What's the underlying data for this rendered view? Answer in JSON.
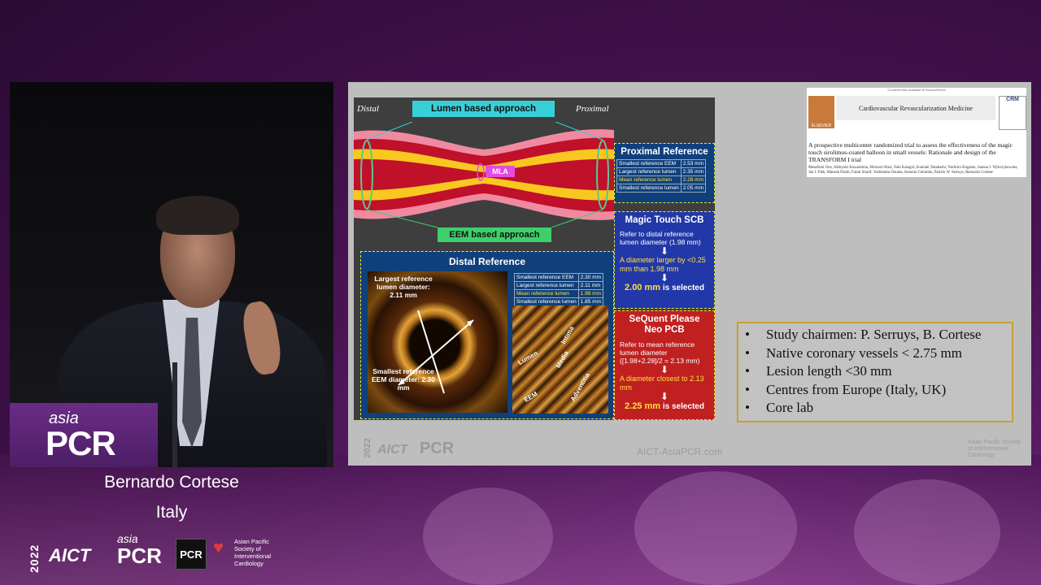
{
  "speaker": {
    "name": "Bernardo Cortese",
    "country": "Italy"
  },
  "branding": {
    "year": "2022",
    "aict": "AICT",
    "asia": "asia",
    "pcr": "PCR",
    "pcr_box": "PCR",
    "society": "Asian Pacific Society of Interventional Cardiology"
  },
  "podium": {
    "small": "asia",
    "big": "PCR"
  },
  "slide": {
    "diagram": {
      "label_distal": "Distal",
      "label_proximal": "Proximal",
      "lumen_badge": "Lumen based approach",
      "eem_badge": "EEM based approach",
      "mla": "MLA",
      "proximal_ref": {
        "title": "Proximal Reference",
        "rows": [
          {
            "label": "Smallest reference EEM",
            "value": "2.53 mm"
          },
          {
            "label": "Largest reference lumen",
            "value": "2.35 mm"
          },
          {
            "label": "Mean reference lumen",
            "value": "2.28 mm"
          },
          {
            "label": "Smallest reference lumen",
            "value": "2.05 mm"
          }
        ]
      },
      "distal_ref": {
        "title": "Distal Reference",
        "largest_label": "Largest reference lumen diameter: 2.11 mm",
        "smallest_label": "Smallest reference EEM diameter: 2.30 mm",
        "rows": [
          {
            "label": "Smallest reference EEM",
            "value": "2.30 mm"
          },
          {
            "label": "Largest reference lumen",
            "value": "2.11 mm"
          },
          {
            "label": "Mean reference lumen",
            "value": "1.98 mm"
          },
          {
            "label": "Smallest reference lumen",
            "value": "1.85 mm"
          }
        ],
        "layers": [
          "Lumen",
          "Intima",
          "Media",
          "Adventitia",
          "EEM"
        ]
      },
      "scb": {
        "title": "Magic Touch SCB",
        "text1": "Refer to distal reference lumen diameter (1.98 mm)",
        "text2": "A diameter larger by <0.25 mm than 1.98 mm",
        "result_value": "2.00 mm",
        "result_suffix": " is selected"
      },
      "pcb": {
        "title": "SeQuent Please Neo PCB",
        "text1": "Refer to mean reference lumen diameter ([1.98+2.28]/2 = 2.13 mm)",
        "text2": "A diameter closest to 2.13 mm",
        "result_value": "2.25 mm",
        "result_suffix": " is selected"
      }
    },
    "paper": {
      "top": "Contents lists available at ScienceDirect",
      "journal": "Cardiovascular Revascularization Medicine",
      "publisher": "ELSEVIER",
      "crm": "CRM",
      "title": "A prospective multicenter randomized trial to assess the effectiveness of the magic touch sirolimus-coated balloon in small vessels: Rationale and design of the TRANSFORM I trial",
      "authors": "Masafumi Ono, Hideyuki Kawashima, Hironori Hara, Yuki Katagiri, Kuniaki Takahashi, Norihiro Kogame, Joanna J. Wykrzykowska, Jan J. Piek, Manesh Doshi, Faisal Sharif, Yoshinobu Onuma, Antonio Colombo, Patrick W. Serruys, Bernardo Cortese"
    },
    "bullets": [
      "Study chairmen: P. Serruys, B. Cortese",
      "Native coronary vessels < 2.75 mm",
      "Lesion length <30 mm",
      "Centres from Europe (Italy, UK)",
      "Core lab"
    ],
    "footer": {
      "year": "2022",
      "aict": "AICT",
      "pcr": "PCR",
      "url": "AICT-AsiaPCR.com",
      "society": "Asian Pacific Society of Interventional Cardiology"
    }
  },
  "colors": {
    "background": "#4a1454",
    "slide": "#bebebe",
    "accent": "#c8a030"
  }
}
